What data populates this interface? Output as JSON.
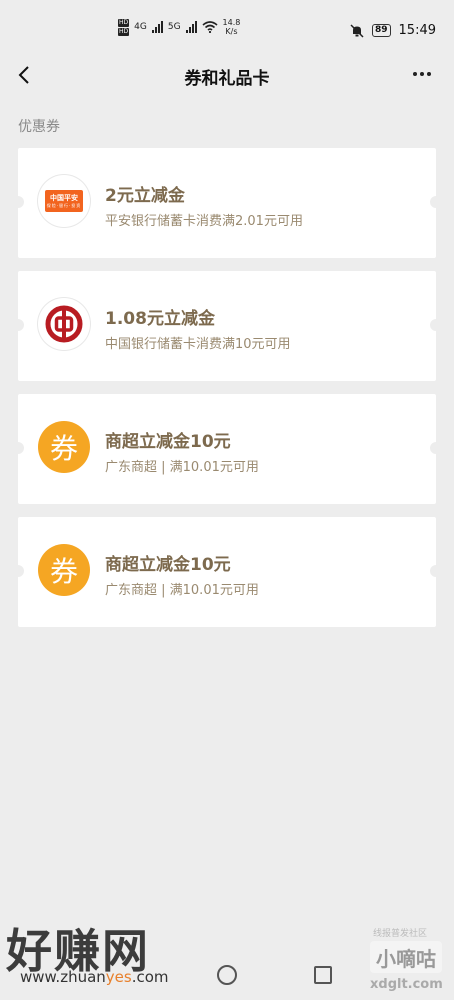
{
  "status_bar": {
    "net_speed_value": "14.8",
    "net_speed_unit": "K/s",
    "net_type_1": "4G",
    "net_type_2": "5G",
    "hd_label": "HD",
    "battery": "89",
    "time": "15:49"
  },
  "header": {
    "title": "券和礼品卡"
  },
  "section": {
    "title": "优惠券"
  },
  "coupons": [
    {
      "title": "2元立减金",
      "subtitle": "平安银行储蓄卡消费满2.01元可用",
      "logo_text": "中国平安",
      "logo_subtext": "保险·银行·投资",
      "icon": "ping-an-logo"
    },
    {
      "title": "1.08元立减金",
      "subtitle": "中国银行储蓄卡消费满10元可用",
      "icon": "bank-of-china-logo"
    },
    {
      "title": "商超立减金10元",
      "subtitle": "广东商超 | 满10.01元可用",
      "logo_text": "券",
      "icon": "coupon-icon"
    },
    {
      "title": "商超立减金10元",
      "subtitle": "广东商超 | 满10.01元可用",
      "logo_text": "券",
      "icon": "coupon-icon"
    }
  ],
  "watermarks": {
    "left_main": "好赚网",
    "left_url_1": "www.zhuan",
    "left_url_2": "yes",
    "left_url_3": ".com",
    "right_top": "线报普发社区",
    "right_main": "小嘀咕",
    "right_url": "xdglt.com"
  },
  "colors": {
    "accent_title": "#7d6a4e",
    "coupon_orange": "#f5a623",
    "ping_an_orange": "#f2641f",
    "boc_red": "#b81c22"
  }
}
